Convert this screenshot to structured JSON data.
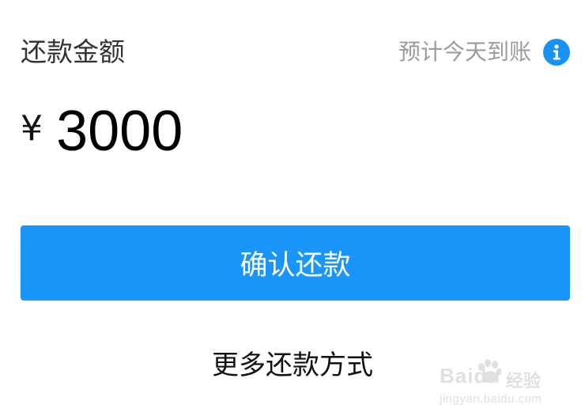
{
  "header": {
    "amount_label": "还款金额",
    "arrival_text": "预计今天到账",
    "info_icon": "info-icon"
  },
  "amount": {
    "currency": "¥",
    "value": "3000"
  },
  "actions": {
    "confirm_label": "确认还款",
    "more_methods_label": "更多还款方式"
  },
  "watermark": {
    "brand": "Baidu",
    "cn": "经验",
    "url": "jingyan.baidu.com"
  },
  "colors": {
    "primary": "#1a96fb",
    "info_icon": "#1a92f2",
    "muted_text": "#9b9b9b"
  }
}
